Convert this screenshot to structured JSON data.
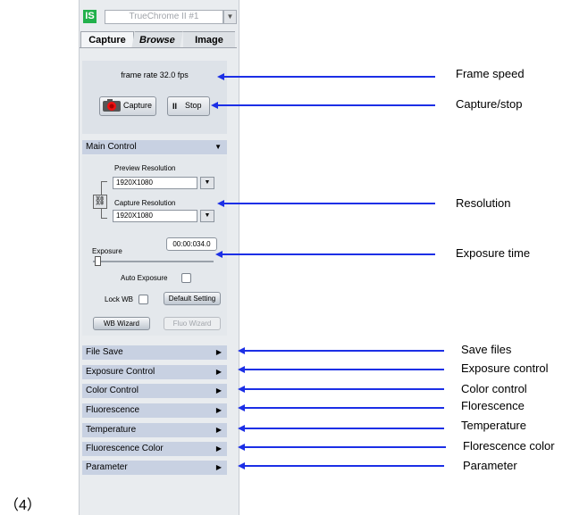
{
  "header": {
    "logo": "IS",
    "camera": "TrueChrome II #1"
  },
  "tabs": [
    "Capture",
    "Browse",
    "Image"
  ],
  "capture_panel": {
    "frame_rate": "frame rate 32.0 fps",
    "capture_label": "Capture",
    "stop_label": "Stop"
  },
  "main_control": {
    "title": "Main Control",
    "preview_label": "Preview Resolution",
    "preview_value": "1920X1080",
    "capture_label": "Capture Resolution",
    "capture_value": "1920X1080",
    "exposure_label": "Exposure",
    "exposure_time": "00:00:034.0",
    "auto_exposure": "Auto Exposure",
    "lock_wb": "Lock WB",
    "default_setting": "Default Setting",
    "wb_wizard": "WB Wizard",
    "fluo_wizard": "Fluo Wizard"
  },
  "sections": [
    "File Save",
    "Exposure Control",
    "Color Control",
    "Fluorescence",
    "Temperature",
    "Fluorescence Color",
    "Parameter"
  ],
  "annotations": [
    "Frame speed",
    "Capture/stop",
    "Resolution",
    "Exposure time",
    "Save files",
    "Exposure control",
    "Color control",
    "Florescence",
    "Temperature",
    "Florescence color",
    "Parameter"
  ],
  "figure_label": "（4）",
  "colors": {
    "arrow": "#1c2fe6",
    "section": "#c8d1e2",
    "logo": "#22b14c"
  }
}
